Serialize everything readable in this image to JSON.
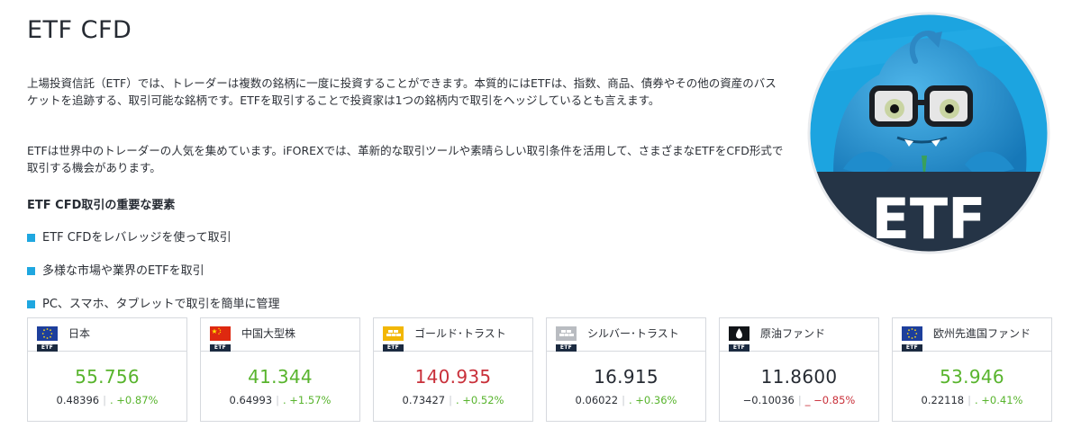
{
  "title": "ETF CFD",
  "intro": {
    "paragraph1": "上場投資信託（ETF）では、トレーダーは複数の銘柄に一度に投資することができます。本質的にはETFは、指数、商品、債券やその他の資産のバスケットを追跡する、取引可能な銘柄です。ETFを取引することで投資家は1つの銘柄内で取引をヘッジしているとも言えます。",
    "paragraph2": "ETFは世界中のトレーダーの人気を集めています。iFOREXでは、革新的な取引ツールや素晴らしい取引条件を活用して、さまざまなETFをCFD形式で取引する機会があります。"
  },
  "features": {
    "heading": "ETF CFD取引の重要な要素",
    "items": [
      "ETF CFDをレバレッジを使って取引",
      "多様な市場や業界のETFを取引",
      "PC、スマホ、タブレットで取引を簡単に管理"
    ]
  },
  "mascot": {
    "label": "ETF",
    "accent": "#1fa7e0",
    "band": "#253446"
  },
  "flag_label": "ETF",
  "colors": {
    "up": "#58b42d",
    "down": "#c9303a",
    "bullet": "#1fa7e0"
  },
  "cards": [
    {
      "name": "日本",
      "icon": "eu-flag-icon",
      "price": "55.756",
      "change": "0.48396",
      "pct": "+0.87%",
      "direction": "up",
      "price_color": "up"
    },
    {
      "name": "中国大型株",
      "icon": "china-flag-icon",
      "price": "41.344",
      "change": "0.64993",
      "pct": "+1.57%",
      "direction": "up",
      "price_color": "up"
    },
    {
      "name": "ゴールド･トラスト",
      "icon": "gold-bars-icon",
      "price": "140.935",
      "change": "0.73427",
      "pct": "+0.52%",
      "direction": "up",
      "price_color": "down"
    },
    {
      "name": "シルバー･トラスト",
      "icon": "silver-bars-icon",
      "price": "16.915",
      "change": "0.06022",
      "pct": "+0.36%",
      "direction": "up",
      "price_color": "flat"
    },
    {
      "name": "原油ファンド",
      "icon": "oil-drop-icon",
      "price": "11.8600",
      "change": "−0.10036",
      "pct": "−0.85%",
      "direction": "down",
      "price_color": "flat"
    },
    {
      "name": "欧州先進国ファンド",
      "icon": "eu-flag-icon",
      "price": "53.946",
      "change": "0.22118",
      "pct": "+0.41%",
      "direction": "up",
      "price_color": "up"
    }
  ]
}
